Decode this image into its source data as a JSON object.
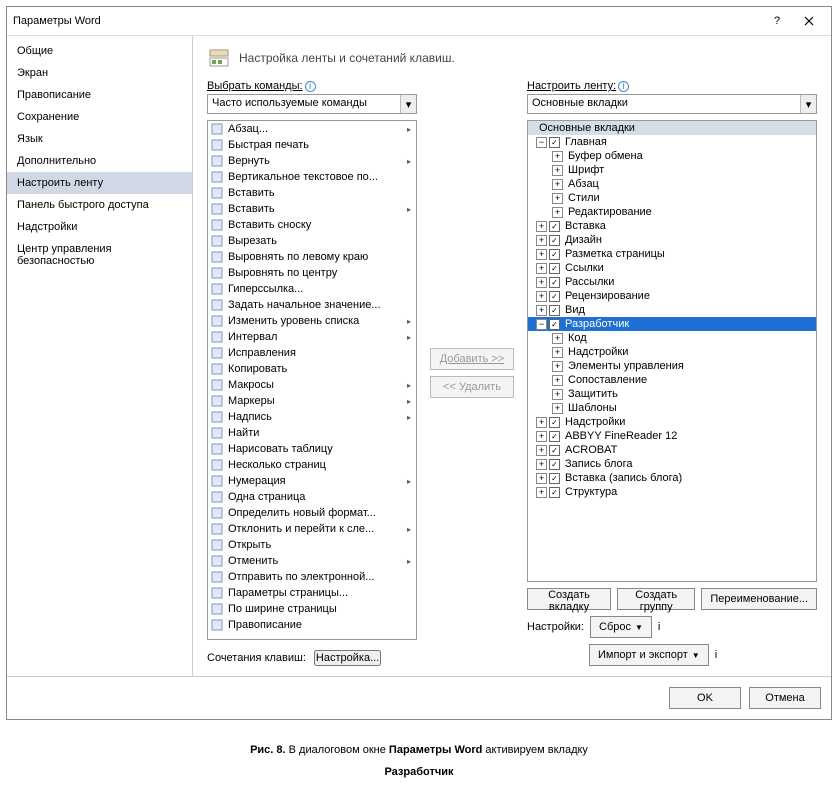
{
  "title": "Параметры Word",
  "sidebar": [
    {
      "label": "Общие"
    },
    {
      "label": "Экран"
    },
    {
      "label": "Правописание"
    },
    {
      "label": "Сохранение"
    },
    {
      "label": "Язык"
    },
    {
      "label": "Дополнительно"
    },
    {
      "label": "Настроить ленту",
      "selected": true
    },
    {
      "label": "Панель быстрого доступа"
    },
    {
      "label": "Надстройки"
    },
    {
      "label": "Центр управления безопасностью"
    }
  ],
  "section_title": "Настройка ленты и сочетаний клавиш.",
  "left_label": "Выбрать команды:",
  "left_combo": "Часто используемые команды",
  "right_label": "Настроить ленту:",
  "right_combo": "Основные вкладки",
  "commands": [
    {
      "t": "Абзац...",
      "e": true
    },
    {
      "t": "Быстрая печать"
    },
    {
      "t": "Вернуть",
      "e": true
    },
    {
      "t": "Вертикальное текстовое по..."
    },
    {
      "t": "Вставить"
    },
    {
      "t": "Вставить",
      "e": true
    },
    {
      "t": "Вставить сноску"
    },
    {
      "t": "Вырезать"
    },
    {
      "t": "Выровнять по левому краю"
    },
    {
      "t": "Выровнять по центру"
    },
    {
      "t": "Гиперссылка..."
    },
    {
      "t": "Задать начальное значение..."
    },
    {
      "t": "Изменить уровень списка",
      "e": true
    },
    {
      "t": "Интервал",
      "e": true
    },
    {
      "t": "Исправления"
    },
    {
      "t": "Копировать"
    },
    {
      "t": "Макросы",
      "e": true
    },
    {
      "t": "Маркеры",
      "e": true
    },
    {
      "t": "Надпись",
      "e": true
    },
    {
      "t": "Найти"
    },
    {
      "t": "Нарисовать таблицу"
    },
    {
      "t": "Несколько страниц"
    },
    {
      "t": "Нумерация",
      "e": true
    },
    {
      "t": "Одна страница"
    },
    {
      "t": "Определить новый формат..."
    },
    {
      "t": "Отклонить и перейти к сле...",
      "e": true
    },
    {
      "t": "Открыть"
    },
    {
      "t": "Отменить",
      "e": true
    },
    {
      "t": "Отправить по электронной..."
    },
    {
      "t": "Параметры страницы..."
    },
    {
      "t": "По ширине страницы"
    },
    {
      "t": "Правописание"
    }
  ],
  "tree": [
    {
      "d": 0,
      "header": true,
      "label": "Основные вкладки"
    },
    {
      "d": 0,
      "tg": "−",
      "ck": true,
      "label": "Главная"
    },
    {
      "d": 1,
      "tg": "+",
      "label": "Буфер обмена"
    },
    {
      "d": 1,
      "tg": "+",
      "label": "Шрифт"
    },
    {
      "d": 1,
      "tg": "+",
      "label": "Абзац"
    },
    {
      "d": 1,
      "tg": "+",
      "label": "Стили"
    },
    {
      "d": 1,
      "tg": "+",
      "label": "Редактирование"
    },
    {
      "d": 0,
      "tg": "+",
      "ck": true,
      "label": "Вставка"
    },
    {
      "d": 0,
      "tg": "+",
      "ck": true,
      "label": "Дизайн"
    },
    {
      "d": 0,
      "tg": "+",
      "ck": true,
      "label": "Разметка страницы"
    },
    {
      "d": 0,
      "tg": "+",
      "ck": true,
      "label": "Ссылки"
    },
    {
      "d": 0,
      "tg": "+",
      "ck": true,
      "label": "Рассылки"
    },
    {
      "d": 0,
      "tg": "+",
      "ck": true,
      "label": "Рецензирование"
    },
    {
      "d": 0,
      "tg": "+",
      "ck": true,
      "label": "Вид"
    },
    {
      "d": 0,
      "tg": "−",
      "ck": true,
      "label": "Разработчик",
      "sel": true
    },
    {
      "d": 1,
      "tg": "+",
      "label": "Код"
    },
    {
      "d": 1,
      "tg": "+",
      "label": "Надстройки"
    },
    {
      "d": 1,
      "tg": "+",
      "label": "Элементы управления"
    },
    {
      "d": 1,
      "tg": "+",
      "label": "Сопоставление"
    },
    {
      "d": 1,
      "tg": "+",
      "label": "Защитить"
    },
    {
      "d": 1,
      "tg": "+",
      "label": "Шаблоны"
    },
    {
      "d": 0,
      "tg": "+",
      "ck": true,
      "label": "Надстройки"
    },
    {
      "d": 0,
      "tg": "+",
      "ck": true,
      "label": "ABBYY FineReader 12"
    },
    {
      "d": 0,
      "tg": "+",
      "ck": true,
      "label": "ACROBAT"
    },
    {
      "d": 0,
      "tg": "+",
      "ck": true,
      "label": "Запись блога"
    },
    {
      "d": 0,
      "tg": "+",
      "ck": true,
      "label": "Вставка (запись блога)"
    },
    {
      "d": 0,
      "tg": "+",
      "ck": true,
      "label": "Структура"
    }
  ],
  "btn_add": "Добавить >>",
  "btn_remove": "<< Удалить",
  "btn_new_tab": "Создать вкладку",
  "btn_new_grp": "Создать группу",
  "btn_rename": "Переименование...",
  "lbl_settings": "Настройки:",
  "btn_reset": "Сброс",
  "btn_import": "Импорт и экспорт",
  "lbl_kb": "Сочетания клавиш:",
  "btn_kb": "Настройка...",
  "btn_ok": "OK",
  "btn_cancel": "Отмена",
  "caption_label": "Рис. 8.",
  "caption_1": " В диалоговом окне ",
  "caption_b1": "Параметры Word",
  "caption_2": " активируем вкладку ",
  "caption_b2": "Разработчик"
}
